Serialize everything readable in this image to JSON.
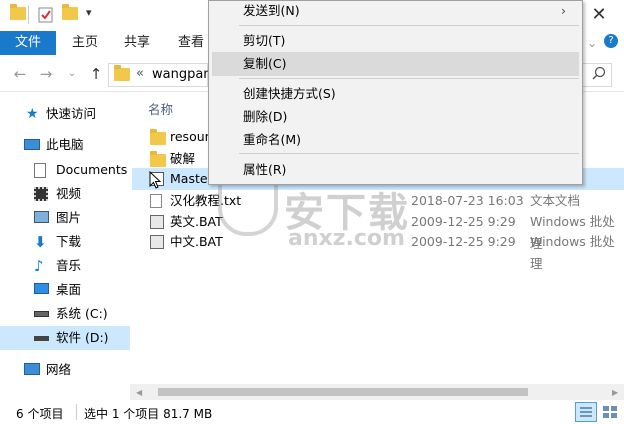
{
  "quick_access_toolbar": {
    "customize_glyph": "▾"
  },
  "ribbon": {
    "tabs": [
      "文件",
      "主页",
      "共享",
      "查看"
    ],
    "help_glyph": "?"
  },
  "window": {
    "close_glyph": "✕"
  },
  "address": {
    "path_prefix": "«",
    "path_text": "wangpan"
  },
  "sidebar": {
    "quick_access": "快速访问",
    "this_pc": "此电脑",
    "items": [
      "Documents",
      "视频",
      "图片",
      "下载",
      "音乐",
      "桌面",
      "系统 (C:)",
      "软件 (D:)"
    ],
    "network": "网络"
  },
  "file_list": {
    "header_name": "名称",
    "rows": [
      {
        "name": "resour",
        "date": "",
        "type": "",
        "icon": "folder-icon"
      },
      {
        "name": "破解",
        "date": "",
        "type": "",
        "icon": "folder-icon"
      },
      {
        "name": "Master",
        "date": "",
        "type": "",
        "icon": "exe-icon"
      },
      {
        "name": "汉化教程.txt",
        "date": "2018-07-23 16:03",
        "type": "文本文档",
        "icon": "text-file-icon"
      },
      {
        "name": "英文.BAT",
        "date": "2009-12-25 9:29",
        "type": "Windows 批处理",
        "icon": "bat-file-icon"
      },
      {
        "name": "中文.BAT",
        "date": "2009-12-25 9:29",
        "type": "Windows 批处理",
        "icon": "bat-file-icon"
      }
    ]
  },
  "context_menu": {
    "send_to": "发送到(N)",
    "cut": "剪切(T)",
    "copy": "复制(C)",
    "create_shortcut": "创建快捷方式(S)",
    "delete": "删除(D)",
    "rename": "重命名(M)",
    "properties": "属性(R)"
  },
  "watermark": {
    "text": "安下载",
    "sub": "anxz.com"
  },
  "status_bar": {
    "item_count": "6 个项目",
    "selection": "选中 1 个项目 81.7 MB"
  },
  "colors": {
    "accent": "#1979ca",
    "selection": "#cce8ff",
    "menu_bg": "#f2f2f2",
    "menu_hover": "#dadada"
  }
}
